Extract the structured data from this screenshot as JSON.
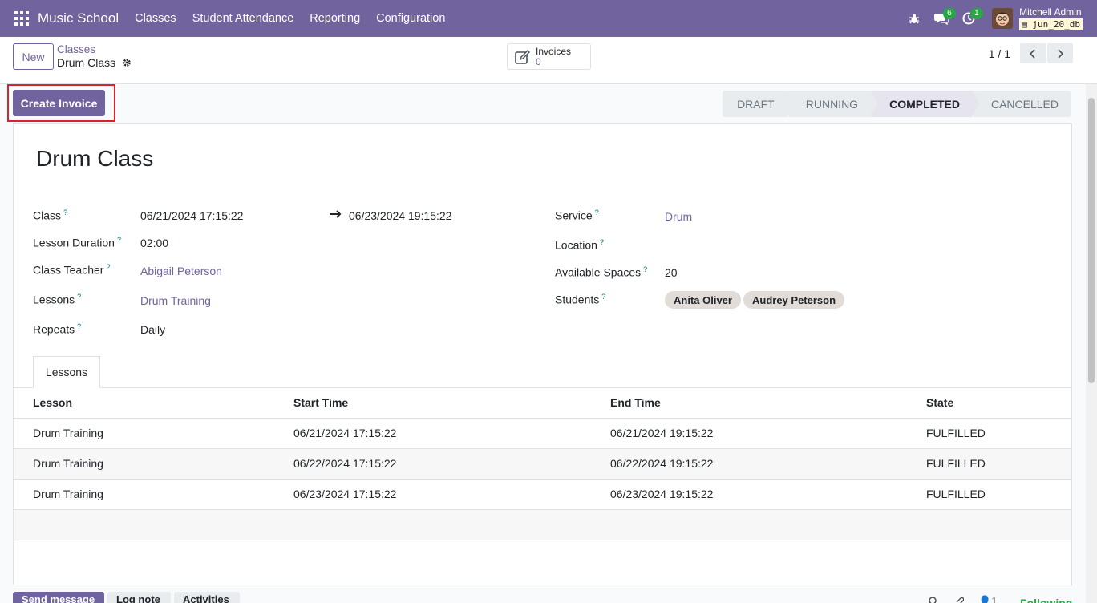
{
  "navbar": {
    "brand": "Music School",
    "menu": [
      "Classes",
      "Student Attendance",
      "Reporting",
      "Configuration"
    ],
    "messages_count": "6",
    "activities_count": "1",
    "user_name": "Mitchell Admin",
    "db_name": "jun_20_db"
  },
  "control": {
    "new_label": "New",
    "breadcrumb_parent": "Classes",
    "breadcrumb_current": "Drum Class",
    "stat_label": "Invoices",
    "stat_value": "0",
    "pager": "1 / 1"
  },
  "statusbar": {
    "create_invoice_label": "Create Invoice",
    "stages": [
      {
        "label": "DRAFT",
        "active": false
      },
      {
        "label": "RUNNING",
        "active": false
      },
      {
        "label": "COMPLETED",
        "active": true
      },
      {
        "label": "CANCELLED",
        "active": false
      }
    ]
  },
  "form": {
    "title": "Drum Class",
    "help_mark": "?",
    "labels": {
      "class": "Class",
      "lesson_duration": "Lesson Duration",
      "class_teacher": "Class Teacher",
      "lessons": "Lessons",
      "repeats": "Repeats",
      "service": "Service",
      "location": "Location",
      "available_spaces": "Available Spaces",
      "students": "Students"
    },
    "values": {
      "class_start": "06/21/2024 17:15:22",
      "class_end": "06/23/2024 19:15:22",
      "lesson_duration": "02:00",
      "class_teacher": "Abigail Peterson",
      "lessons": "Drum Training",
      "repeats": "Daily",
      "service": "Drum",
      "location": "",
      "available_spaces": "20",
      "students": [
        "Anita Oliver",
        "Audrey Peterson"
      ]
    }
  },
  "tabs": {
    "active": "Lessons"
  },
  "lessons_table": {
    "headers": [
      "Lesson",
      "Start Time",
      "End Time",
      "State"
    ],
    "rows": [
      [
        "Drum Training",
        "06/21/2024 17:15:22",
        "06/21/2024 19:15:22",
        "FULFILLED"
      ],
      [
        "Drum Training",
        "06/22/2024 17:15:22",
        "06/22/2024 19:15:22",
        "FULFILLED"
      ],
      [
        "Drum Training",
        "06/23/2024 17:15:22",
        "06/23/2024 19:15:22",
        "FULFILLED"
      ]
    ]
  },
  "chatter": {
    "send_message": "Send message",
    "log_note": "Log note",
    "activities": "Activities",
    "followers_count": "1",
    "following": "Following"
  },
  "colors": {
    "brand": "#71639e",
    "highlight": "#d9232a",
    "badge": "#28a745"
  }
}
